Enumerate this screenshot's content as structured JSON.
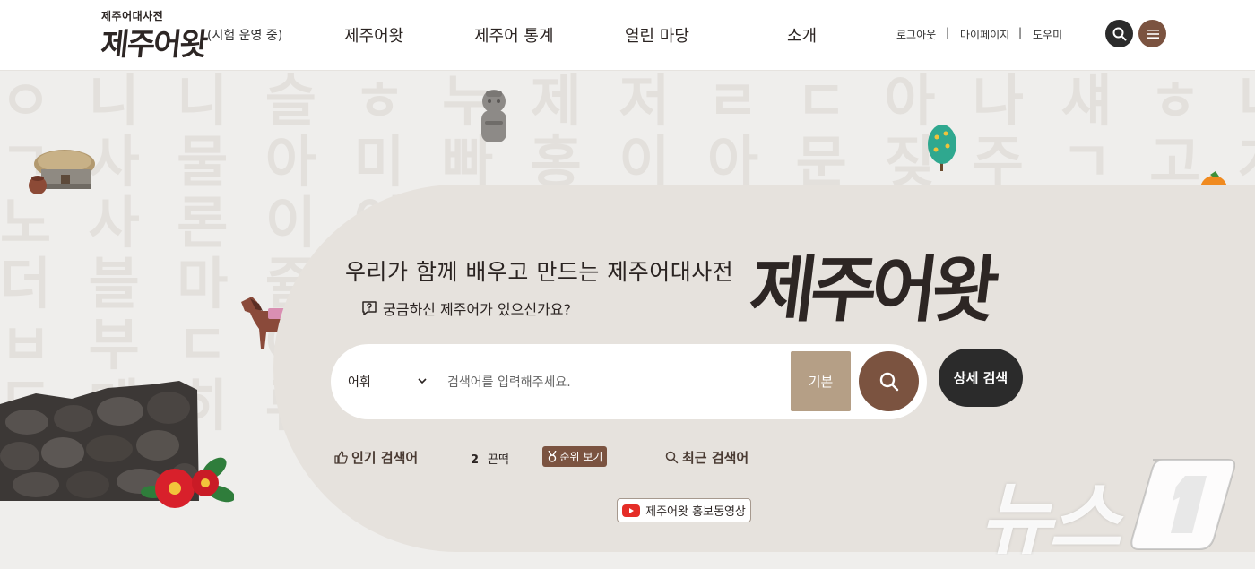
{
  "header": {
    "logo_small": "제주어대사전",
    "logo_big": "제주어왓",
    "status": "(시험 운영 중)",
    "nav": [
      "제주어왓",
      "제주어 통계",
      "열린 마당",
      "소개"
    ],
    "util_links": [
      "로그아웃",
      "마이페이지",
      "도우미"
    ],
    "separator": "|"
  },
  "hero": {
    "background_text": "ㅇ 니 니 슬 ㅎ 누 제 저 ㄹ ㄷ 아 나 섀 ㅎ 니 니 슬\nㄱ 사 물 아 미 빠 홍 이 아 문 짖 주 ㄱ 고 게 사 물\n노 사 론 이 어 기 류 제 그 니 알 이 나 어 빼 ㄴ\n더 블 마 쥴 리 퍼 개 두 스 제 게 아 문 부 ㄷ 수\nㅂ 부 ㄷ 아 둬 기 모 ㄴ 우 리 리 스 ㅎ 파 물 피 ㅇ\n도 메 히 류 지 새 ㅎ 그 가 디 지 하 투 부 ㅇ",
    "title": "우리가 함께 배우고 만드는 제주어대사전",
    "logo": "제주어왓",
    "subtitle": "궁금하신 제주어가 있으신가요?"
  },
  "search": {
    "select_value": "어휘",
    "placeholder": "검색어를 입력해주세요.",
    "mode_button": "기본",
    "advanced_button": "상세 검색"
  },
  "popular": {
    "label": "인기 검색어",
    "rank_number": "2",
    "rank_word": "끈떡",
    "rank_button": "순위 보기"
  },
  "recent": {
    "label": "최근 검색어"
  },
  "promo": {
    "label": "제주어왓 홍보동영상"
  },
  "watermark": {
    "text": "뉴스"
  },
  "colors": {
    "brown": "#7b5340",
    "tan": "#b59f86",
    "dark": "#2b2b2b",
    "background": "#efeeec",
    "panel": "#e6e2dd"
  }
}
